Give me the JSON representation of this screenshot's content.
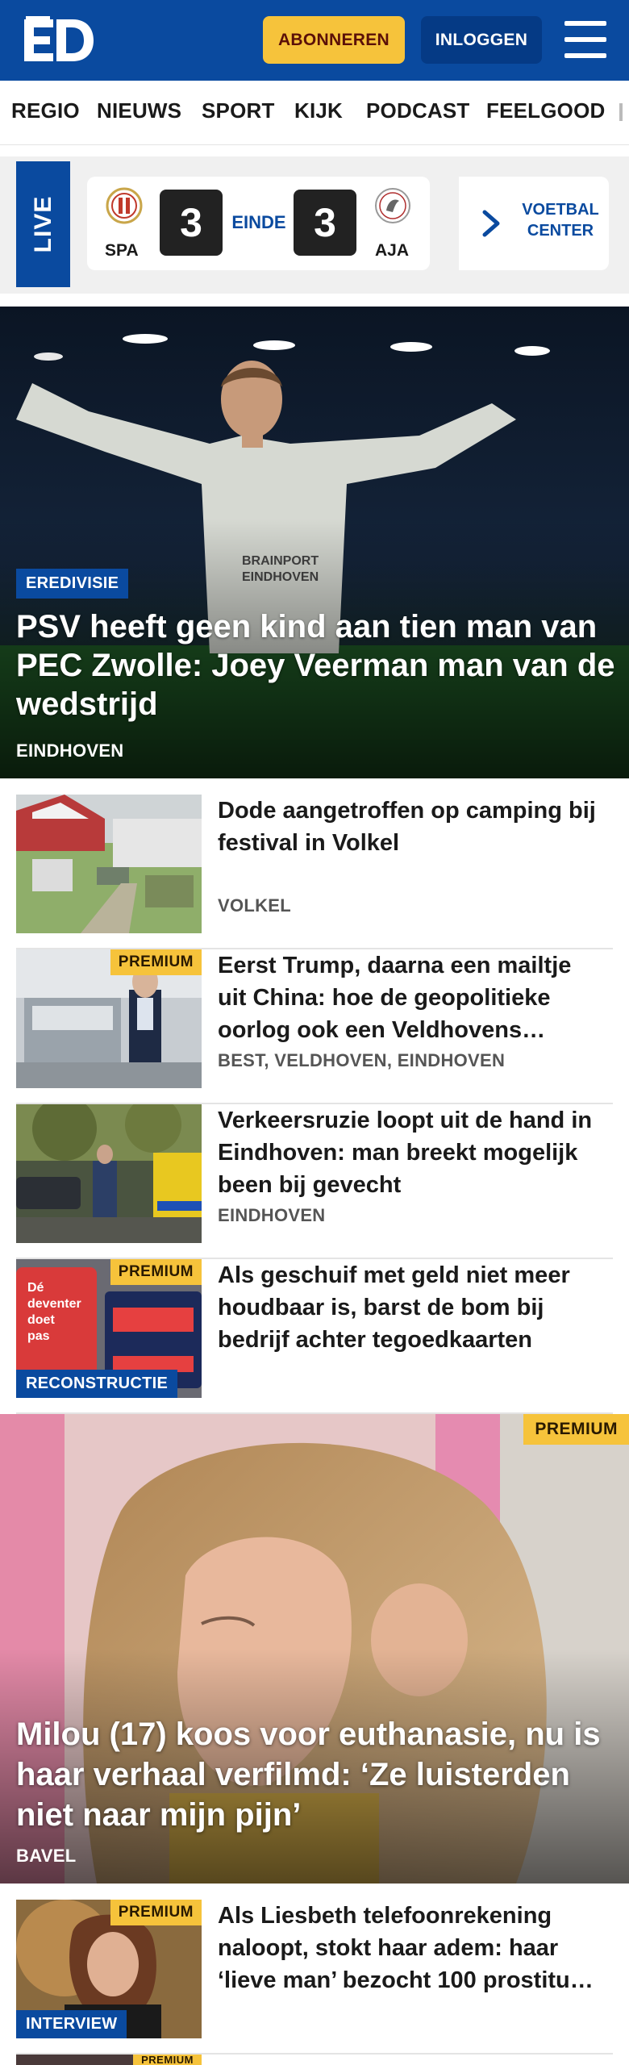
{
  "header": {
    "logo_text": "ED",
    "subscribe_label": "ABONNEREN",
    "login_label": "INLOGGEN",
    "menu_icon": "hamburger-menu-icon"
  },
  "nav": {
    "items": [
      "REGIO",
      "NIEUWS",
      "SPORT",
      "KIJK",
      "PODCAST",
      "FEELGOOD"
    ]
  },
  "live": {
    "label": "LIVE",
    "home_code": "SPA",
    "home_score": "3",
    "status": "EINDE",
    "away_score": "3",
    "away_code": "AJA",
    "center_label": "VOETBAL CENTER"
  },
  "hero": {
    "category": "EREDIVISIE",
    "title": "PSV heeft geen kind aan tien man van PEC Zwolle: Joey Veerman man van de wedstrijd",
    "location": "EINDHOVEN"
  },
  "articles": [
    {
      "title": "Dode aangetroffen op camping bij festival in Volkel",
      "location": "VOLKEL",
      "premium": "",
      "category": ""
    },
    {
      "title": "Eerst Trump, daarna een mailtje uit China: hoe de geopolitieke oorlog ook een Veldhovens…",
      "location": "BEST, VELDHOVEN, EINDHOVEN",
      "premium": "PREMIUM",
      "category": ""
    },
    {
      "title": "Verkeersruzie loopt uit de hand in Eindhoven: man breekt mogelijk been bij gevecht",
      "location": "EINDHOVEN",
      "premium": "",
      "category": ""
    },
    {
      "title": "Als geschuif met geld niet meer houdbaar is, barst de bom bij bedrijf achter tegoedkaarten",
      "location": "",
      "premium": "PREMIUM",
      "category": "RECONSTRUCTIE"
    }
  ],
  "feature": {
    "premium": "PREMIUM",
    "title": "Milou (17) koos voor euthanasie, nu is haar verhaal verfilmd: ‘Ze luisterden niet naar mijn pijn’",
    "location": "BAVEL"
  },
  "article_interview": {
    "title": "Als Liesbeth telefoonrekening naloopt, stokt haar adem: haar ‘lieve man’ bezocht 100 prostitu…",
    "premium": "PREMIUM",
    "category": "INTERVIEW"
  },
  "article_next": {
    "premium": "PREMIUM"
  },
  "colors": {
    "brand_blue": "#0a4a9f",
    "premium_yellow": "#f6c33b",
    "login_blue": "#053a85"
  }
}
